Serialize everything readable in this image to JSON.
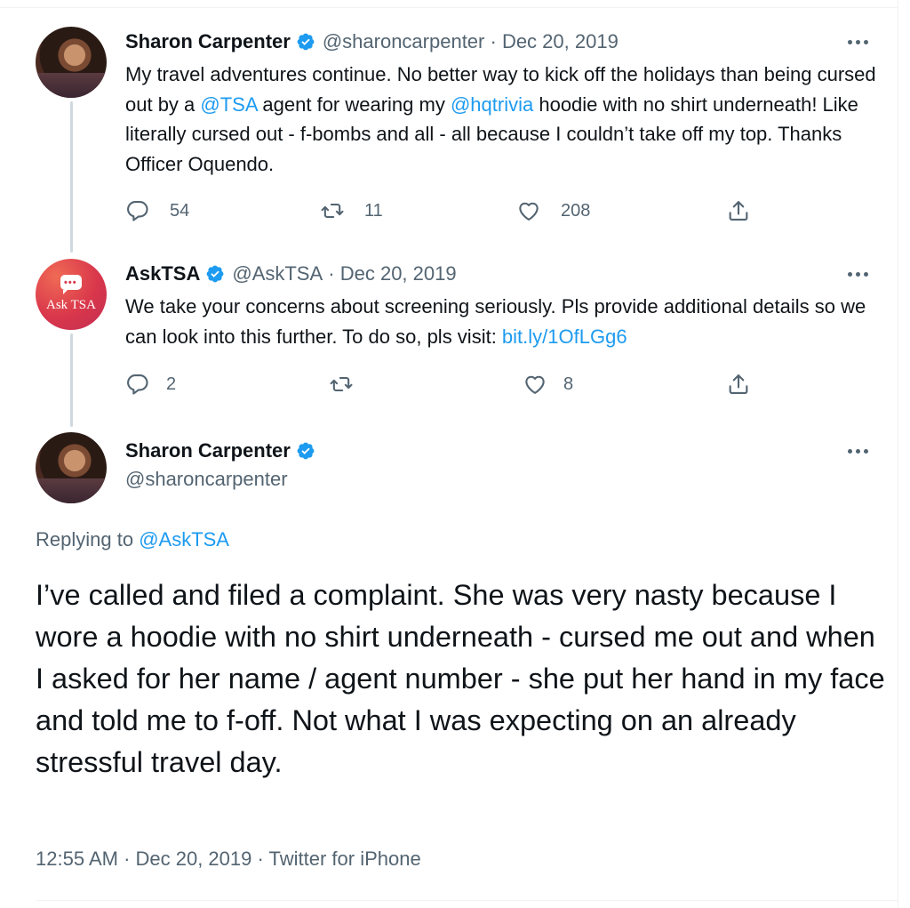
{
  "tweets": [
    {
      "name": "Sharon Carpenter",
      "handle": "@sharoncarpenter",
      "date": "Dec 20, 2019",
      "text_parts": [
        "My travel adventures continue. No better way to kick off the holidays than being cursed out by a ",
        "@TSA",
        " agent for wearing my ",
        "@hqtrivia",
        " hoodie with no shirt underneath! Like literally cursed out - f-bombs and all - all because I couldn’t take off my top. Thanks Officer Oquendo."
      ],
      "replies": "54",
      "retweets": "11",
      "likes": "208"
    },
    {
      "name": "AskTSA",
      "avatar_text": "Ask TSA",
      "handle": "@AskTSA",
      "date": "Dec 20, 2019",
      "text_parts": [
        "We take your concerns about screening seriously. Pls provide additional details so we can look into this further. To do so, pls visit: ",
        "bit.ly/1OfLGg6"
      ],
      "replies": "2",
      "retweets": "",
      "likes": "8"
    }
  ],
  "main_tweet": {
    "name": "Sharon Carpenter",
    "handle": "@sharoncarpenter",
    "replying_prefix": "Replying to ",
    "replying_to": "@AskTSA",
    "text": "I’ve called and filed a complaint. She was very nasty because I wore a hoodie with no shirt underneath - cursed me out and when I asked for her name / agent number - she put her hand in my face and told me to f-off. Not what I was expecting on an already stressful travel day.",
    "timestamp": "12:55 AM · Dec 20, 2019 · Twitter for iPhone"
  },
  "colors": {
    "link": "#1d9bf0",
    "secondary_text": "#536471",
    "verified": "#1d9bf0",
    "thread_line": "#cfd9de"
  },
  "icons": [
    "reply-icon",
    "retweet-icon",
    "like-icon",
    "share-icon",
    "verified-badge-icon",
    "more-options-icon"
  ]
}
